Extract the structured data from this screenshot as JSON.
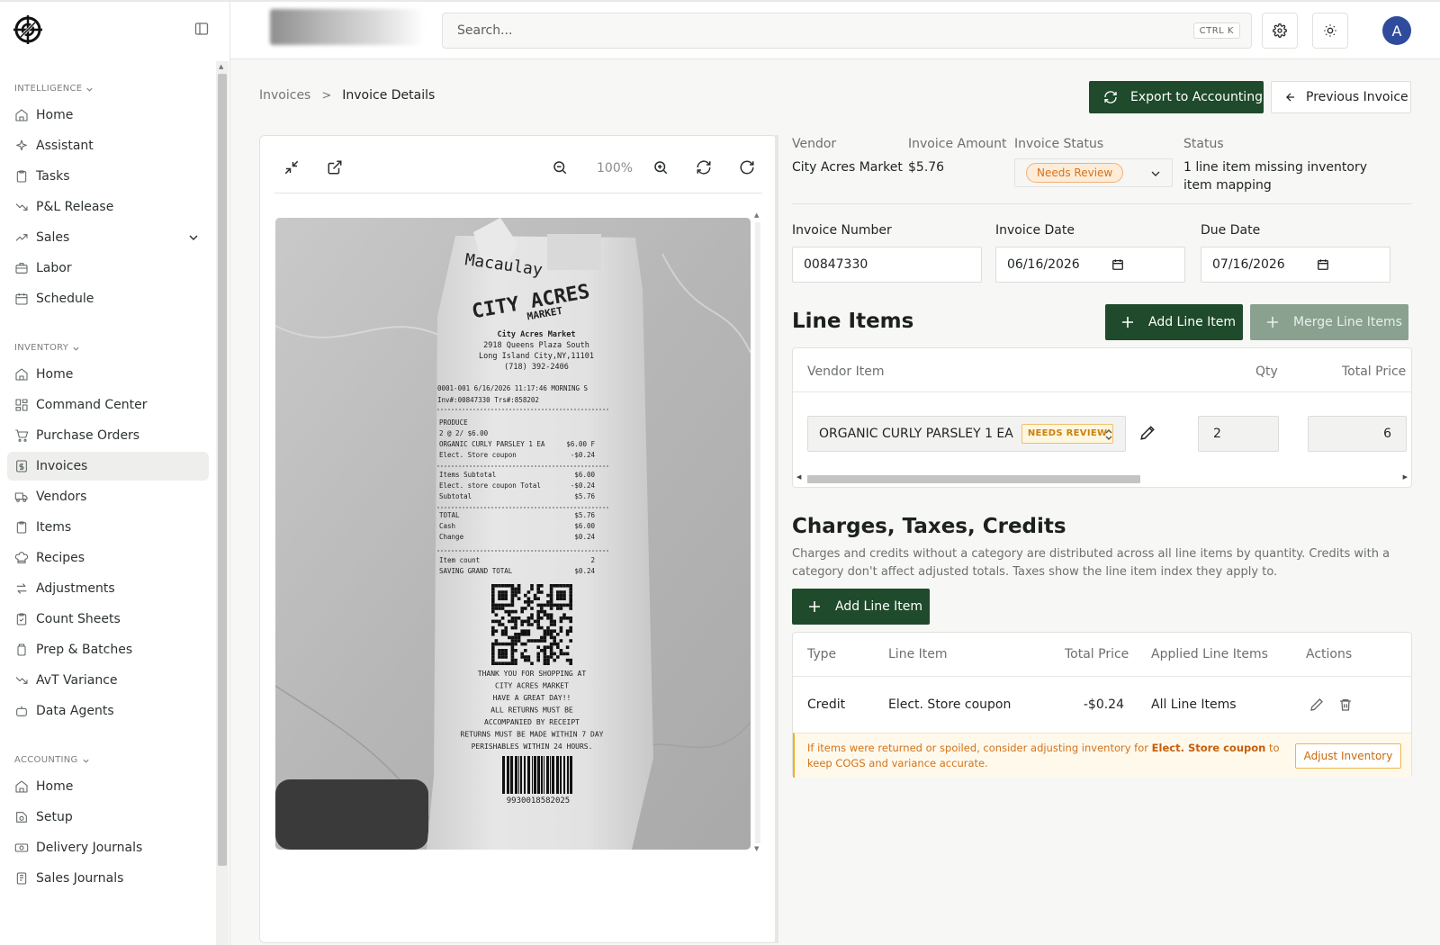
{
  "search": {
    "placeholder": "Search...",
    "shortcut": "CTRL K"
  },
  "user": {
    "initial": "A"
  },
  "sidebar": {
    "sections": [
      {
        "title": "INTELLIGENCE",
        "items": [
          {
            "label": "Home",
            "icon": "home-icon"
          },
          {
            "label": "Assistant",
            "icon": "sparkle-icon"
          },
          {
            "label": "Tasks",
            "icon": "clipboard-icon"
          },
          {
            "label": "P&L Release",
            "icon": "trend-down-icon"
          },
          {
            "label": "Sales",
            "icon": "trend-up-icon",
            "expandable": true
          },
          {
            "label": "Labor",
            "icon": "briefcase-icon"
          },
          {
            "label": "Schedule",
            "icon": "calendar-icon"
          }
        ]
      },
      {
        "title": "INVENTORY",
        "items": [
          {
            "label": "Home",
            "icon": "home-icon"
          },
          {
            "label": "Command Center",
            "icon": "grid-icon"
          },
          {
            "label": "Purchase Orders",
            "icon": "cart-icon"
          },
          {
            "label": "Invoices",
            "icon": "invoice-icon",
            "active": true
          },
          {
            "label": "Vendors",
            "icon": "truck-icon"
          },
          {
            "label": "Items",
            "icon": "clipboard-icon"
          },
          {
            "label": "Recipes",
            "icon": "chef-icon"
          },
          {
            "label": "Adjustments",
            "icon": "arrows-icon"
          },
          {
            "label": "Count Sheets",
            "icon": "clipboard-check-icon"
          },
          {
            "label": "Prep & Batches",
            "icon": "jar-icon"
          },
          {
            "label": "AvT Variance",
            "icon": "trend-down-icon"
          },
          {
            "label": "Data Agents",
            "icon": "robot-icon"
          }
        ]
      },
      {
        "title": "ACCOUNTING",
        "items": [
          {
            "label": "Home",
            "icon": "home-icon"
          },
          {
            "label": "Setup",
            "icon": "setup-icon"
          },
          {
            "label": "Delivery Journals",
            "icon": "money-icon"
          },
          {
            "label": "Sales Journals",
            "icon": "journal-icon"
          }
        ]
      }
    ]
  },
  "breadcrumb": {
    "parent": "Invoices",
    "separator": ">",
    "current": "Invoice Details"
  },
  "actions": {
    "export": "Export to Accounting",
    "previous": "Previous Invoice"
  },
  "viewer": {
    "zoom": "100%"
  },
  "receipt": {
    "handwriting": "Macaulay",
    "logo_line1": "CITY ACRES",
    "logo_line2": "MARKET",
    "header": [
      "City Acres Market",
      "2918 Queens Plaza South",
      "Long Island City,NY,11101",
      "(718) 392-2406"
    ],
    "meta": [
      "0001-001 6/16/2026 11:17:46 MORNING S",
      "Inv#:00847330 Trs#:858202"
    ],
    "items": [
      [
        "PRODUCE",
        ""
      ],
      [
        "2 @ 2/ $6.00",
        ""
      ],
      [
        "ORGANIC CURLY PARSLEY 1 EA",
        "$6.00 F"
      ],
      [
        "Elect. Store coupon",
        "-$0.24"
      ]
    ],
    "totals": [
      [
        "Items Subtotal",
        "$6.00"
      ],
      [
        "Elect. store coupon Total",
        "-$0.24"
      ],
      [
        "Subtotal",
        "$5.76"
      ]
    ],
    "payment": [
      [
        "TOTAL",
        "$5.76"
      ],
      [
        "Cash",
        "$6.00"
      ],
      [
        "Change",
        "$0.24"
      ]
    ],
    "count": [
      [
        "Item count",
        "2"
      ],
      [
        "SAVING GRAND TOTAL",
        "$0.24"
      ]
    ],
    "footer": [
      "THANK YOU FOR SHOPPING AT",
      "CITY ACRES MARKET",
      "HAVE A GREAT DAY!!",
      "ALL RETURNS MUST BE",
      "ACCOMPANIED BY RECEIPT",
      "RETURNS MUST BE MADE WITHIN 7 DAY",
      "PERISHABLES WITHIN 24 HOURS."
    ],
    "barcode": "9930018582025"
  },
  "invoice": {
    "vendor_label": "Vendor",
    "vendor": "City Acres Market",
    "amount_label": "Invoice Amount",
    "amount": "$5.76",
    "status_label": "Invoice Status",
    "status": "Needs Review",
    "status2_label": "Status",
    "status2": "1 line item missing inventory item mapping",
    "number_label": "Invoice Number",
    "number": "00847330",
    "date_label": "Invoice Date",
    "date": "06/16/2026",
    "due_label": "Due Date",
    "due": "07/16/2026"
  },
  "line_items": {
    "title": "Line Items",
    "add_label": "Add Line Item",
    "merge_label": "Merge Line Items",
    "columns": [
      "Vendor Item",
      "Qty",
      "Total Price"
    ],
    "rows": [
      {
        "vendor_item": "ORGANIC CURLY PARSLEY 1 EA",
        "badge": "NEEDS REVIEW",
        "qty": "2",
        "total": "6"
      }
    ]
  },
  "charges": {
    "title": "Charges, Taxes, Credits",
    "description": "Charges and credits without a category are distributed across all line items by quantity. Credits with a category don't affect adjusted totals. Taxes show the line item index they apply to.",
    "add_label": "Add Line Item",
    "columns": [
      "Type",
      "Line Item",
      "Total Price",
      "Applied Line Items",
      "Actions"
    ],
    "rows": [
      {
        "type": "Credit",
        "line_item": "Elect. Store coupon",
        "total": "-$0.24",
        "applied": "All Line Items"
      }
    ],
    "alert_pre": "If items were returned or spoiled, consider adjusting inventory for ",
    "alert_bold": "Elect. Store coupon",
    "alert_post": " to keep COGS and variance accurate.",
    "alert_button": "Adjust Inventory"
  },
  "colors": {
    "primary": "#1f4a2b",
    "primary_disabled": "#8aa18f",
    "warning": "#d6721a",
    "avatar": "#2f4b9c"
  }
}
